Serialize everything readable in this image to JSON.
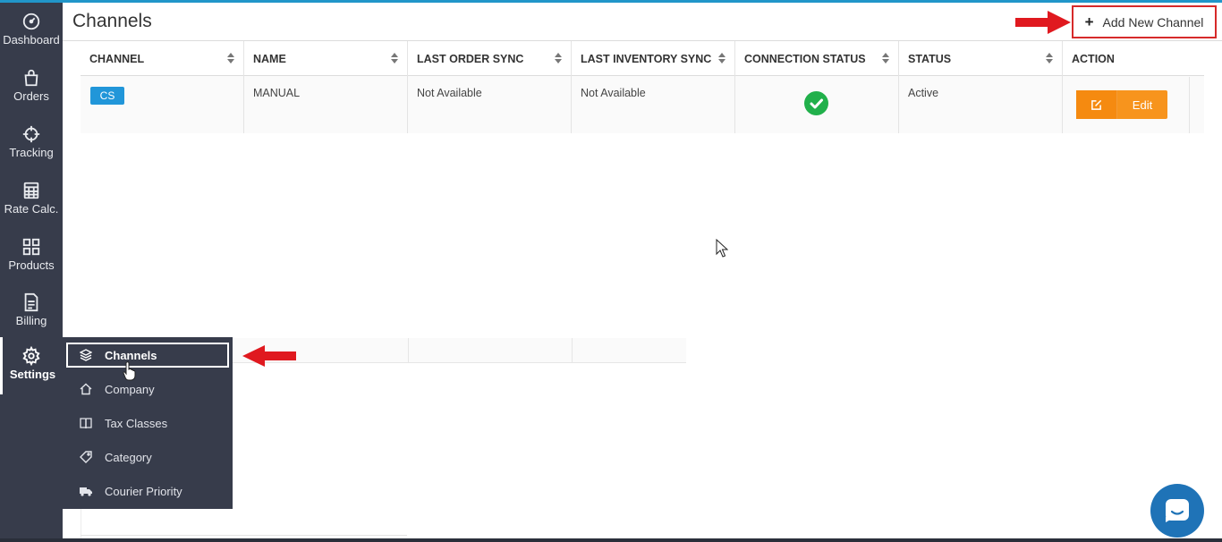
{
  "page": {
    "title": "Channels",
    "add_button_label": "Add New Channel"
  },
  "sidebar": {
    "items": [
      {
        "label": "Dashboard",
        "icon": "dashboard-icon"
      },
      {
        "label": "Orders",
        "icon": "bag-icon"
      },
      {
        "label": "Tracking",
        "icon": "crosshair-icon"
      },
      {
        "label": "Rate Calc.",
        "icon": "calculator-icon"
      },
      {
        "label": "Products",
        "icon": "grid-icon"
      },
      {
        "label": "Billing",
        "icon": "document-icon"
      },
      {
        "label": "Settings",
        "icon": "gear-icon"
      }
    ]
  },
  "table": {
    "headers": [
      "CHANNEL",
      "NAME",
      "LAST ORDER SYNC",
      "LAST INVENTORY SYNC",
      "CONNECTION STATUS",
      "STATUS",
      "ACTION"
    ],
    "rows": [
      {
        "channel": "CS",
        "name": "MANUAL",
        "last_order_sync": "Not Available",
        "last_inventory_sync": "Not Available",
        "connection_status": "connected",
        "status": "Active",
        "action": "Edit"
      }
    ]
  },
  "settings_menu": {
    "items": [
      {
        "label": "Channels",
        "icon": "layers-icon"
      },
      {
        "label": "Company",
        "icon": "home-icon"
      },
      {
        "label": "Tax Classes",
        "icon": "book-icon"
      },
      {
        "label": "Category",
        "icon": "tag-icon"
      },
      {
        "label": "Courier Priority",
        "icon": "truck-icon"
      }
    ]
  },
  "colors": {
    "sidebar": "#373c4b",
    "accent": "#2196d9",
    "edit": "#f7941d",
    "success": "#21b04b",
    "highlight": "#d62a2a"
  }
}
